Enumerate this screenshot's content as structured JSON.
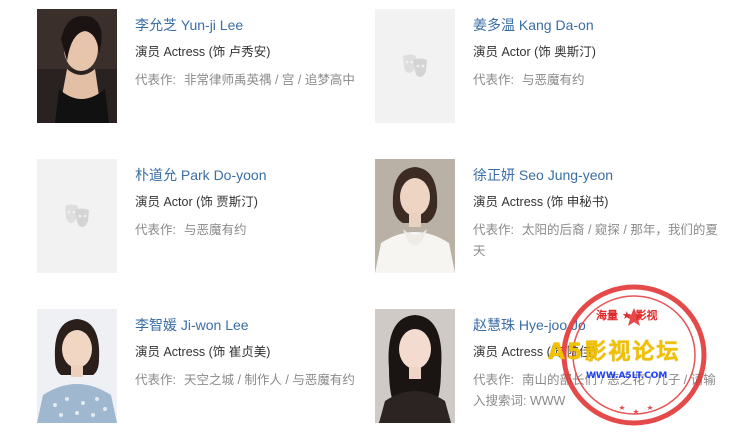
{
  "cast": [
    {
      "name": "李允芝 Yun-ji Lee",
      "role": "演员 Actress (饰 卢秀安)",
      "works_label": "代表作:",
      "works": "非常律师禹英禑 / 宫 / 追梦高中",
      "has_photo": true
    },
    {
      "name": "姜多温 Kang Da-on",
      "role": "演员 Actor (饰 奥斯汀)",
      "works_label": "代表作:",
      "works": "与恶魔有约",
      "has_photo": false
    },
    {
      "name": "朴道允 Park Do-yoon",
      "role": "演员 Actor (饰 贾斯汀)",
      "works_label": "代表作:",
      "works": "与恶魔有约",
      "has_photo": false
    },
    {
      "name": "徐正妍 Seo Jung-yeon",
      "role": "演员 Actress (饰 申秘书)",
      "works_label": "代表作:",
      "works": "太阳的后裔 / 窥探 / 那年，我们的夏天",
      "has_photo": true
    },
    {
      "name": "李智媛 Ji-won Lee",
      "role": "演员 Actress (饰 崔贞美)",
      "works_label": "代表作:",
      "works": "天空之城 / 制作人 / 与恶魔有约",
      "has_photo": true
    },
    {
      "name": "赵慧珠 Hye-joo Jo",
      "role": "演员 Actress (饰 陆佳)",
      "works_label": "代表作:",
      "works": "南山的部长们 / 恶之花 / 儿子 / 请输入搜索词: WWW",
      "has_photo": true
    }
  ],
  "watermark": {
    "main": "A5影视论坛",
    "top": "海量 ★ 影视",
    "url": "WWW.A5LT.COM",
    "colors": {
      "ring": "#e02a2a",
      "main": "#f1c100",
      "url": "#1e40ff"
    }
  },
  "colors": {
    "name_link": "#3a6ea5",
    "muted": "#8a8a8a",
    "placeholder_bg": "#f2f2f2"
  }
}
